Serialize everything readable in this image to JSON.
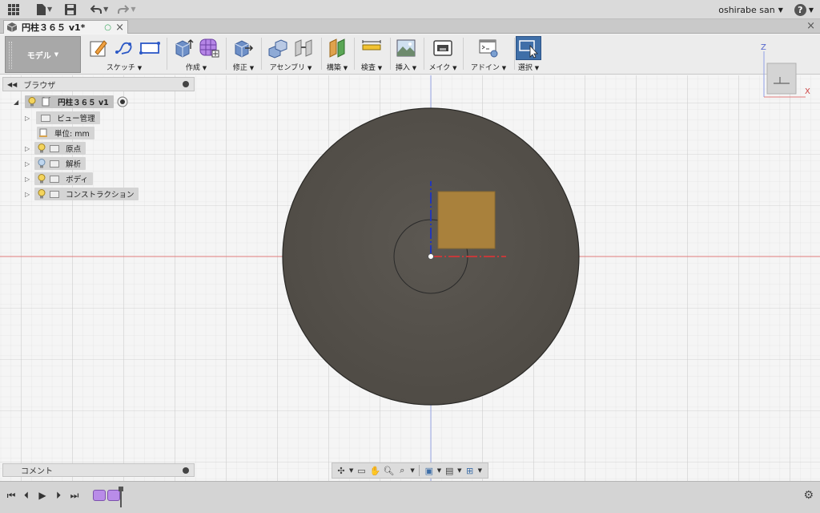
{
  "app": {
    "user_name": "oshirabe san",
    "help_label": "?"
  },
  "document_tab": {
    "title": "円柱３６５ v1*"
  },
  "ribbon": {
    "workspace": "モデル",
    "groups": [
      {
        "label": "スケッチ",
        "icons": [
          "create-sketch-icon",
          "spline-icon",
          "rectangle-icon"
        ]
      },
      {
        "label": "作成",
        "icons": [
          "extrude-icon",
          "form-icon"
        ]
      },
      {
        "label": "修正",
        "icons": [
          "press-pull-icon"
        ]
      },
      {
        "label": "アセンブリ",
        "icons": [
          "new-component-icon",
          "joint-icon"
        ]
      },
      {
        "label": "構築",
        "icons": [
          "offset-plane-icon"
        ]
      },
      {
        "label": "検査",
        "icons": [
          "measure-icon"
        ]
      },
      {
        "label": "挿入",
        "icons": [
          "insert-image-icon"
        ]
      },
      {
        "label": "メイク",
        "icons": [
          "print-3d-icon"
        ]
      },
      {
        "label": "アドイン",
        "icons": [
          "scripts-addins-icon"
        ]
      },
      {
        "label": "選択",
        "icons": [
          "select-icon"
        ]
      }
    ]
  },
  "browser": {
    "title": "ブラウザ",
    "root": "円柱３６５ v1",
    "items": [
      {
        "label": "ビュー管理",
        "bulb": false
      },
      {
        "label": "単位: mm",
        "bulb": false,
        "units": true
      },
      {
        "label": "原点",
        "bulb": true
      },
      {
        "label": "解析",
        "bulb": true
      },
      {
        "label": "ボディ",
        "bulb": true
      },
      {
        "label": "コンストラクション",
        "bulb": true
      }
    ]
  },
  "viewcube": {
    "axis_z": "Z",
    "axis_x": "X"
  },
  "comments": {
    "title": "コメント"
  },
  "colors": {
    "body_fill": "#57534d",
    "sketch_profile": "#a9813c",
    "axis_red": "#c43a3a",
    "axis_blue": "#2236b8",
    "selection_blue": "#3f6fa8"
  }
}
